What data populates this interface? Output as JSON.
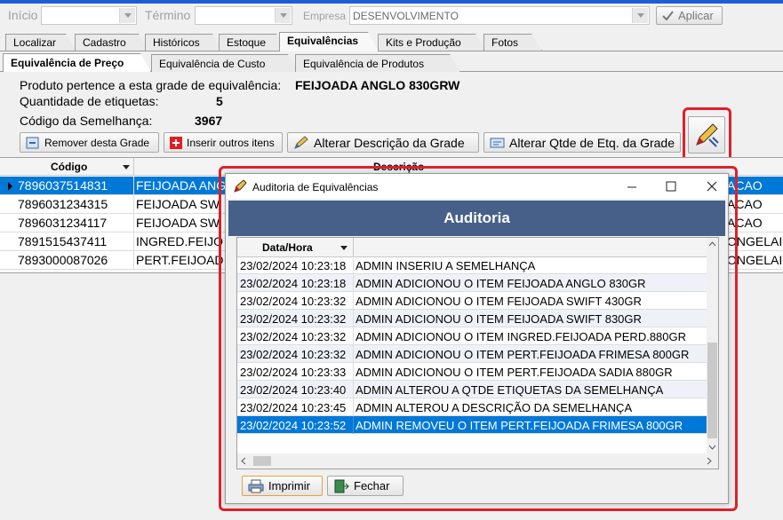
{
  "filters": {
    "inicio_label": "Início",
    "termino_label": "Término",
    "empresa_label": "Empresa",
    "empresa_value": "DESENVOLVIMENTO",
    "apply_label": "Aplicar"
  },
  "main_tabs": [
    "Localizar",
    "Cadastro",
    "Históricos",
    "Estoque",
    "Equivalências",
    "Kits e Produção",
    "Fotos"
  ],
  "sub_tabs": [
    "Equivalência de Preço",
    "Equivalência de Custo",
    "Equivalência de Produtos"
  ],
  "info": {
    "product_label": "Produto pertence a esta grade de equivalência:",
    "product_value": "FEIJOADA ANGLO 830GRW",
    "qty_label": "Quantidade de etiquetas:",
    "qty_value": "5",
    "code_label": "Código da Semelhança:",
    "code_value": "3967"
  },
  "actions": {
    "remove": "Remover desta Grade",
    "insert": "Inserir outros itens",
    "alter_desc": "Alterar Descrição da Grade",
    "alter_qty": "Alterar Qtde de Etq. da Grade"
  },
  "grid": {
    "col_codigo": "Código",
    "col_descricao": "Descrição",
    "rows": [
      {
        "code": "7896037514831",
        "desc": "FEIJOADA ANG",
        "extra": "ACAO"
      },
      {
        "code": "7896031234315",
        "desc": "FEIJOADA SW",
        "extra": "ACAO"
      },
      {
        "code": "7896031234117",
        "desc": "FEIJOADA SW",
        "extra": "ACAO"
      },
      {
        "code": "7891515437411",
        "desc": "INGRED.FEIJO",
        "extra": "ONGELAI"
      },
      {
        "code": "7893000087026",
        "desc": "PERT.FEIJOAD",
        "extra": "ONGELAI"
      }
    ]
  },
  "dialog": {
    "title": "Auditoria de Equivalências",
    "banner": "Auditoria",
    "col_datahora": "Data/Hora",
    "rows": [
      {
        "dt": "23/02/2024 10:23:18",
        "text": "ADMIN INSERIU A SEMELHANÇA"
      },
      {
        "dt": "23/02/2024 10:23:18",
        "text": "ADMIN ADICIONOU O ITEM FEIJOADA ANGLO 830GR"
      },
      {
        "dt": "23/02/2024 10:23:32",
        "text": "ADMIN ADICIONOU O ITEM FEIJOADA SWIFT 430GR"
      },
      {
        "dt": "23/02/2024 10:23:32",
        "text": "ADMIN ADICIONOU O ITEM FEIJOADA SWIFT 830GR"
      },
      {
        "dt": "23/02/2024 10:23:32",
        "text": "ADMIN ADICIONOU O ITEM INGRED.FEIJOADA PERD.880GR"
      },
      {
        "dt": "23/02/2024 10:23:32",
        "text": "ADMIN ADICIONOU O ITEM PERT.FEIJOADA FRIMESA 800GR"
      },
      {
        "dt": "23/02/2024 10:23:33",
        "text": "ADMIN ADICIONOU O ITEM PERT.FEIJOADA SADIA 880GR"
      },
      {
        "dt": "23/02/2024 10:23:40",
        "text": "ADMIN ALTEROU A QTDE ETIQUETAS DA SEMELHANÇA"
      },
      {
        "dt": "23/02/2024 10:23:45",
        "text": "ADMIN ALTEROU A DESCRIÇÃO DA SEMELHANÇA"
      },
      {
        "dt": "23/02/2024 10:23:52",
        "text": "ADMIN REMOVEU O ITEM PERT.FEIJOADA FRIMESA 800GR"
      }
    ],
    "print_label": "Imprimir",
    "close_label": "Fechar"
  },
  "colors": {
    "selection": "#0078d7",
    "banner": "#47608a",
    "highlight": "#e0202a"
  }
}
